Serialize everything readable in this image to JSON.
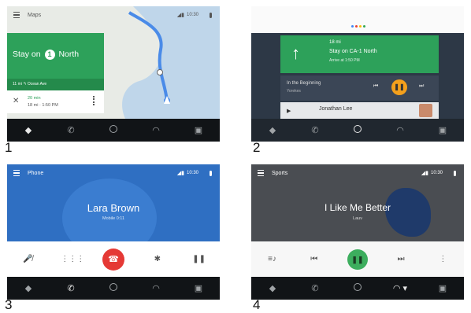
{
  "panel_numbers": [
    "1",
    "2",
    "3",
    "4"
  ],
  "status": {
    "time": "10:30",
    "signal": "◢▮"
  },
  "navbar_icons": [
    "navigation-icon",
    "phone-icon",
    "home-icon",
    "headphones-icon",
    "recents-icon"
  ],
  "maps": {
    "app_title": "Maps",
    "instruction_prefix": "Stay on",
    "route_number": "1",
    "direction": "North",
    "then_text": "11 mi  ↰  Ocean Ave",
    "eta_minutes": "20 min",
    "eta_detail": "18 mi · 1:50 PM",
    "close_symbol": "✕"
  },
  "overview": {
    "nav_line1": "18 mi",
    "nav_line2": "Stay on CA-1 North",
    "nav_line3": "Arrive at 1:50 PM",
    "music_title": "In the Beginning",
    "music_sub": "Yorekes",
    "contact_name": "Jonathan Lee",
    "dot_colors": [
      "#4285f4",
      "#ea4335",
      "#fbbc05",
      "#34a853"
    ]
  },
  "phone": {
    "app_title": "Phone",
    "caller_name": "Lara Brown",
    "caller_sub": "Mobile 0:11"
  },
  "sports": {
    "app_title": "Sports",
    "song_title": "I Like Me Better",
    "artist": "Lauv"
  },
  "colors": {
    "accent_green": "#2da15a",
    "phone_blue": "#2f6fc2",
    "end_red": "#e53935",
    "play_orange": "#f4a01c"
  }
}
